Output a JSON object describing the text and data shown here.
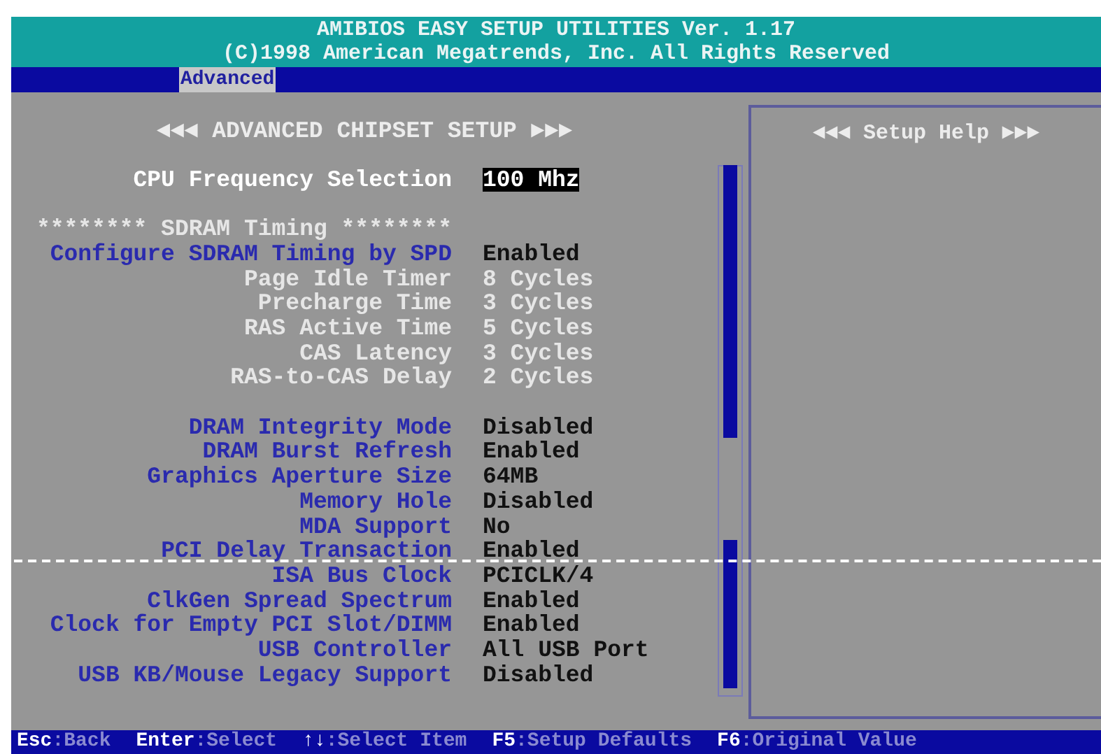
{
  "header": {
    "title": "AMIBIOS EASY SETUP UTILITIES Ver. 1.17",
    "copyright": "(C)1998 American Megatrends, Inc. All Rights Reserved"
  },
  "tabs": [
    {
      "label": "Advanced",
      "selected": true
    }
  ],
  "panel_title": "◄◄◄ ADVANCED CHIPSET SETUP ►►►",
  "groups": [
    {
      "items": [
        {
          "label": "CPU Frequency Selection",
          "value": "100 Mhz",
          "selected": true,
          "disabled": false
        }
      ]
    },
    {
      "heading": "******** SDRAM Timing ********",
      "items": [
        {
          "label": "Configure SDRAM Timing by SPD",
          "value": "Enabled",
          "selected": false,
          "disabled": false
        },
        {
          "label": "Page Idle Timer",
          "value": "8 Cycles",
          "selected": false,
          "disabled": true
        },
        {
          "label": "Precharge Time",
          "value": "3 Cycles",
          "selected": false,
          "disabled": true
        },
        {
          "label": "RAS Active Time",
          "value": "5 Cycles",
          "selected": false,
          "disabled": true
        },
        {
          "label": "CAS Latency",
          "value": "3 Cycles",
          "selected": false,
          "disabled": true
        },
        {
          "label": "RAS-to-CAS Delay",
          "value": "2 Cycles",
          "selected": false,
          "disabled": true
        }
      ]
    },
    {
      "items": [
        {
          "label": "DRAM Integrity Mode",
          "value": "Disabled",
          "selected": false,
          "disabled": false
        },
        {
          "label": "DRAM Burst Refresh",
          "value": "Enabled",
          "selected": false,
          "disabled": false
        },
        {
          "label": "Graphics Aperture Size",
          "value": "64MB",
          "selected": false,
          "disabled": false
        },
        {
          "label": "Memory Hole",
          "value": "Disabled",
          "selected": false,
          "disabled": false
        },
        {
          "label": "MDA Support",
          "value": "No",
          "selected": false,
          "disabled": false
        },
        {
          "label": "PCI Delay Transaction",
          "value": "Enabled",
          "selected": false,
          "disabled": false
        },
        {
          "label": "ISA Bus Clock",
          "value": "PCICLK/4",
          "selected": false,
          "disabled": false
        },
        {
          "label": "ClkGen Spread Spectrum",
          "value": "Enabled",
          "selected": false,
          "disabled": false
        },
        {
          "label": "Clock for Empty PCI Slot/DIMM",
          "value": "Enabled",
          "selected": false,
          "disabled": false
        },
        {
          "label": "USB Controller",
          "value": "All USB Port",
          "selected": false,
          "disabled": false
        },
        {
          "label": "USB KB/Mouse Legacy Support",
          "value": "Disabled",
          "selected": false,
          "disabled": false
        }
      ]
    }
  ],
  "help": {
    "title": "◄◄◄ Setup Help ►►►"
  },
  "status_bar": [
    {
      "key": "Esc",
      "action": ":Back"
    },
    {
      "key": "Enter",
      "action": ":Select"
    },
    {
      "key": "↑↓",
      "action": ":Select Item"
    },
    {
      "key": "F5",
      "action": ":Setup Defaults"
    },
    {
      "key": "F6",
      "action": ":Original Value"
    }
  ]
}
